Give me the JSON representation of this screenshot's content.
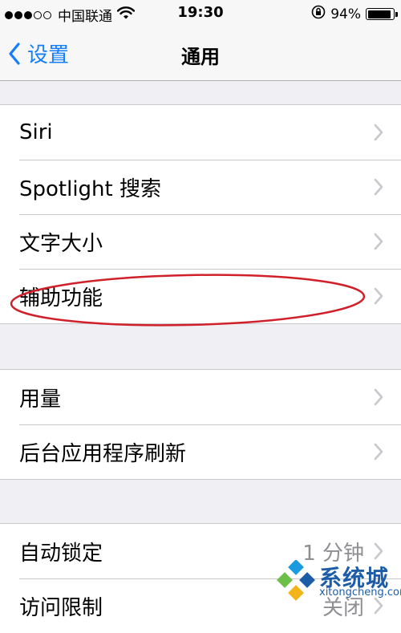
{
  "status_bar": {
    "carrier": "中国联通",
    "time": "19:30",
    "battery_text": "94%",
    "battery_level": 0.94,
    "signal_bars_filled": 3,
    "signal_bars_total": 5
  },
  "nav": {
    "back_label": "设置",
    "title": "通用"
  },
  "groups": [
    {
      "rows": [
        {
          "label": "Siri"
        },
        {
          "label": "Spotlight 搜索"
        },
        {
          "label": "文字大小"
        },
        {
          "label": "辅助功能"
        }
      ]
    },
    {
      "rows": [
        {
          "label": "用量"
        },
        {
          "label": "后台应用程序刷新"
        }
      ]
    },
    {
      "rows": [
        {
          "label": "自动锁定",
          "value": "1 分钟"
        },
        {
          "label": "访问限制",
          "value": "关闭"
        }
      ]
    }
  ],
  "watermark": {
    "text": "系统城",
    "sub": "xitongcheng.com"
  },
  "colors": {
    "accent": "#157efb",
    "highlight": "#d0202a",
    "background": "#efeff4"
  }
}
